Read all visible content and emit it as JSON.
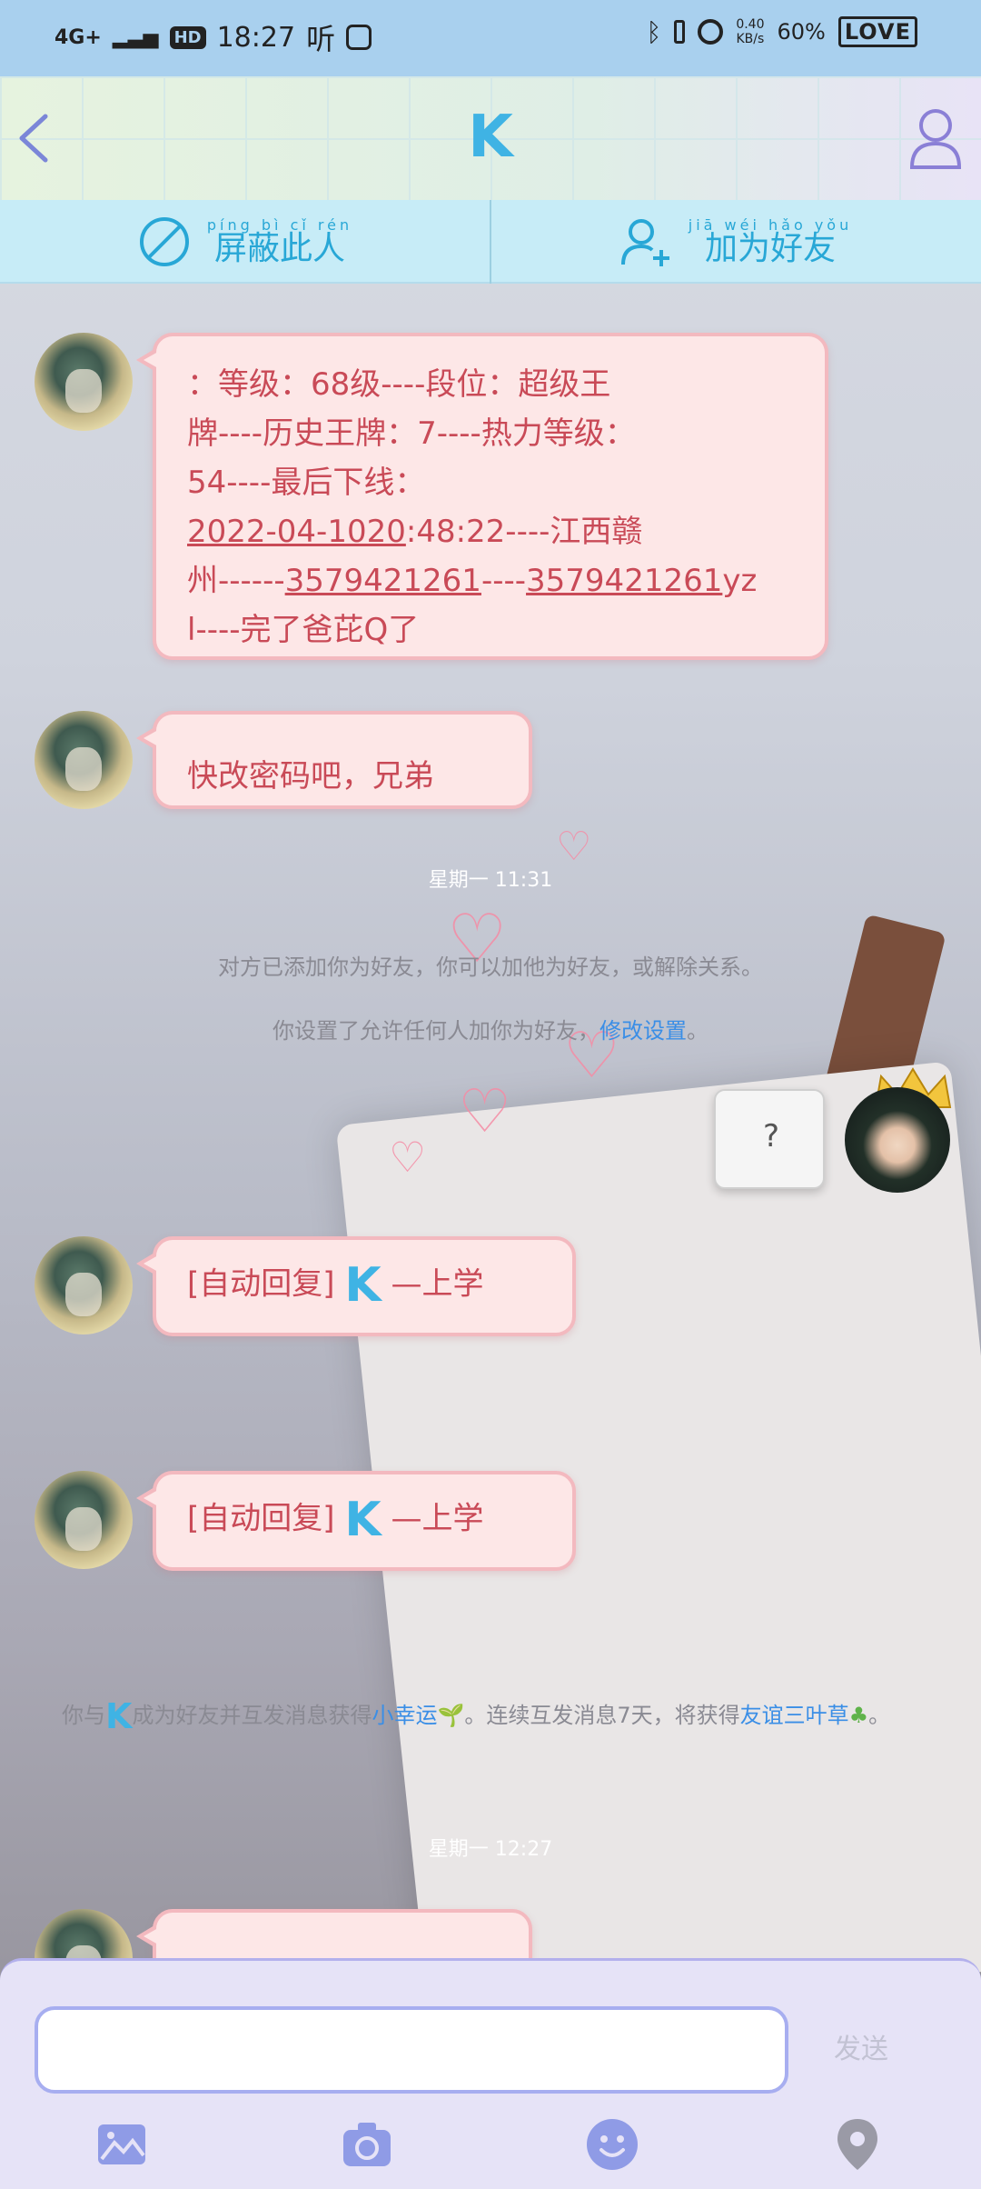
{
  "status_bar": {
    "network": "4G+",
    "hd_badge": "HD",
    "time": "18:27",
    "ting": "听",
    "speed_value": "0.40",
    "speed_unit": "KB/s",
    "battery": "60%",
    "love_badge": "LOVE"
  },
  "header": {
    "title": "K"
  },
  "actions": {
    "block": {
      "label": "屏蔽此人",
      "pinyin": "píng bì cǐ rén"
    },
    "add_friend": {
      "label": "加为好友",
      "pinyin": "jiā wéi hǎo yǒu"
    }
  },
  "messages": {
    "m1": {
      "line1": "：等级：68级----段位：超级王",
      "line2": "牌----历史王牌：7----热力等级：",
      "line3": "54----最后下线：",
      "line4_date": "2022-04-1020",
      "line4_rest": ":48:22----江西赣",
      "line5_a": "州------",
      "line5_num1": "3579421261",
      "line5_b": "----",
      "line5_num2": "3579421261",
      "line5_c": "yz",
      "line6": "l----完了爸芘Q了"
    },
    "m2": "快改密码吧，兄弟",
    "timestamp1": "星期一 11:31",
    "sys1": "对方已添加你为好友，你可以加他为好友，或解除关系。",
    "sys2_text": "你设置了允许任何人加你为好友，",
    "sys2_link": "修改设置",
    "sys2_end": "。",
    "my_note": "?",
    "auto1_prefix": "[自动回复]",
    "auto1_k": "K",
    "auto1_suffix": "—上学",
    "auto2_prefix": "[自动回复]",
    "auto2_k": "K",
    "auto2_suffix": "—上学",
    "sys3_a": "你与",
    "sys3_k": "K",
    "sys3_b": "成为好友并互发消息获得",
    "sys3_link": "小幸运",
    "sys3_c": "。连续互发消息7天，将获得",
    "sys3_link2": "友谊三叶草",
    "sys3_d": "。",
    "timestamp2": "星期一 12:27"
  },
  "input": {
    "placeholder": "",
    "send_label": "发送"
  },
  "toolbar": {
    "image": "image-icon",
    "camera": "camera-icon",
    "emoji": "emoji-icon",
    "location": "location-icon"
  }
}
